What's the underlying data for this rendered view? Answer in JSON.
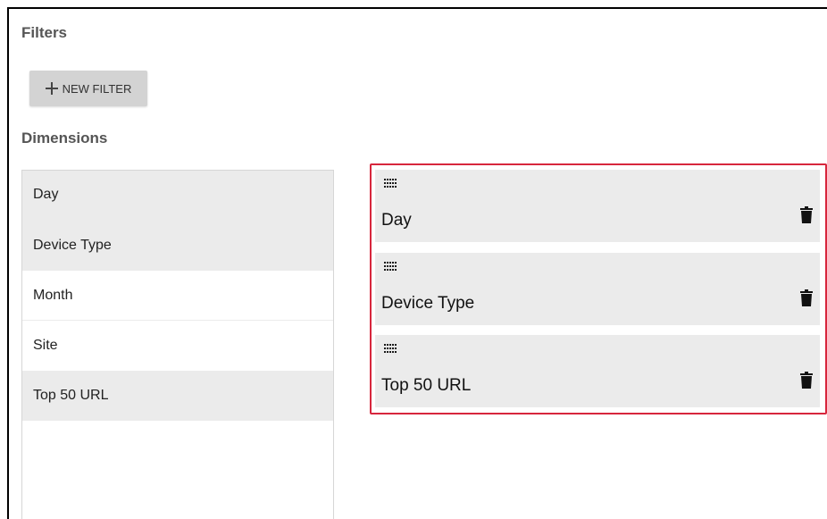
{
  "filters": {
    "title": "Filters",
    "new_filter_label": "NEW FILTER",
    "new_filter_icon": "plus-icon"
  },
  "dimensions": {
    "title": "Dimensions",
    "items": [
      {
        "label": "Day",
        "selected": true
      },
      {
        "label": "Device Type",
        "selected": true
      },
      {
        "label": "Month",
        "selected": false
      },
      {
        "label": "Site",
        "selected": false
      },
      {
        "label": "Top 50 URL",
        "selected": true
      }
    ]
  },
  "selected_dimensions": {
    "highlight_color": "#d7263d",
    "cards": [
      {
        "label": "Day",
        "drag_icon": "drag-grid-icon",
        "delete_icon": "trash-icon"
      },
      {
        "label": "Device Type",
        "drag_icon": "drag-grid-icon",
        "delete_icon": "trash-icon"
      },
      {
        "label": "Top 50 URL",
        "drag_icon": "drag-grid-icon",
        "delete_icon": "trash-icon"
      }
    ]
  }
}
